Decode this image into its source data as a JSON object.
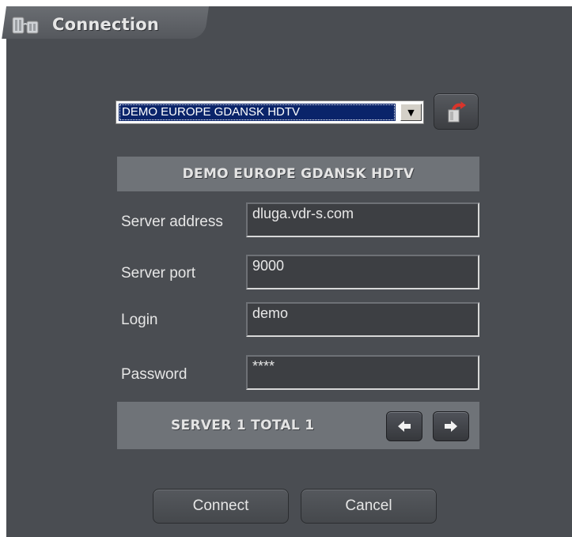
{
  "window": {
    "title": "Connection"
  },
  "profile": {
    "selected": "DEMO EUROPE GDANSK HDTV",
    "header": "DEMO EUROPE GDANSK HDTV"
  },
  "fields": {
    "server_address": {
      "label": "Server address",
      "value": "dluga.vdr-s.com"
    },
    "server_port": {
      "label": "Server port",
      "value": "9000"
    },
    "login": {
      "label": "Login",
      "value": "demo"
    },
    "password": {
      "label": "Password",
      "value": "****"
    }
  },
  "server_bar": {
    "text": "SERVER 1 TOTAL 1"
  },
  "actions": {
    "connect_label": "Connect",
    "cancel_label": "Cancel"
  },
  "icons": {
    "window": "connection-plug-icon",
    "reload": "reload-icon",
    "prev": "arrow-left-icon",
    "next": "arrow-right-icon",
    "dropdown": "chevron-down-icon"
  },
  "colors": {
    "window_bg": "#4a4d52",
    "bar_bg": "#6f7378",
    "selection": "#0a246a",
    "reload_accent": "#d9342b"
  }
}
